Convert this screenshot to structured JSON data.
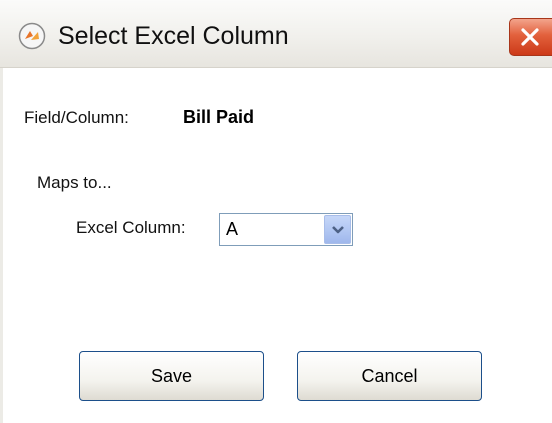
{
  "window": {
    "title": "Select Excel Column",
    "icon": "app-icon",
    "close_icon": "close-icon"
  },
  "field": {
    "label": "Field/Column:",
    "value": "Bill Paid"
  },
  "mapping": {
    "heading": "Maps to...",
    "excel_column_label": "Excel Column:",
    "excel_column_value": "A"
  },
  "buttons": {
    "save_label": "Save",
    "cancel_label": "Cancel"
  },
  "colors": {
    "close_button": "#e2603c",
    "button_border": "#1c4f8a",
    "combo_border": "#7f9db9",
    "dropdown_button": "#b3c8f3"
  }
}
